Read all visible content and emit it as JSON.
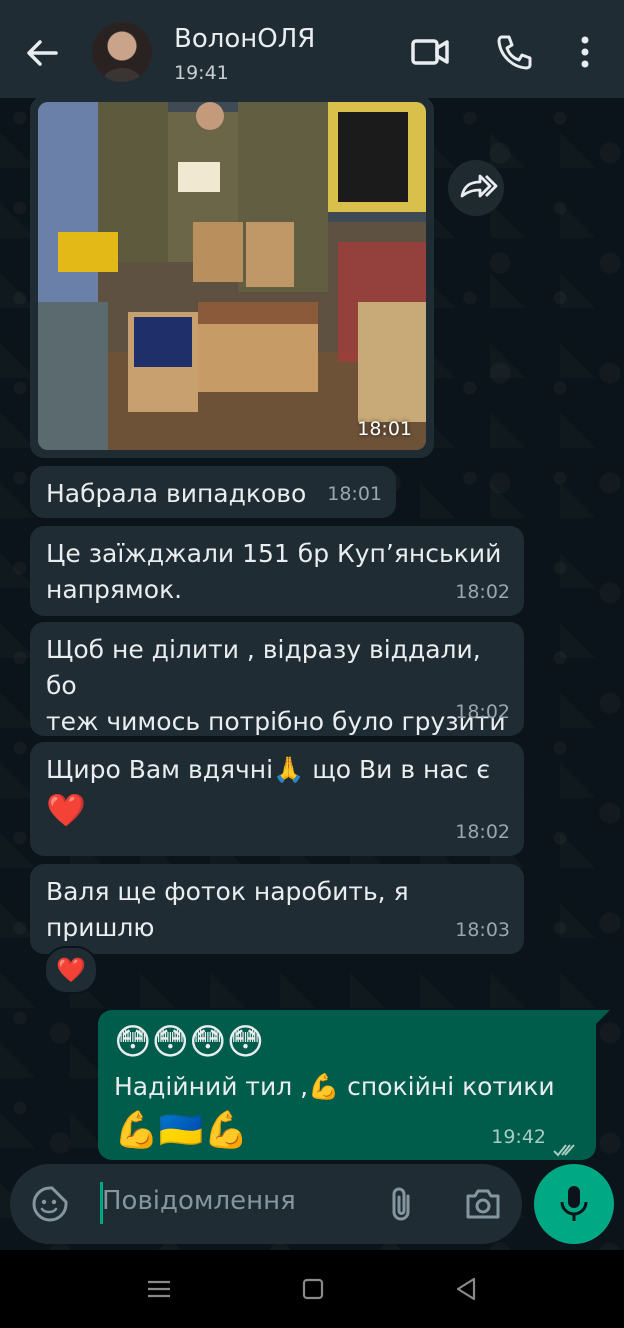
{
  "header": {
    "contact_name": "ВолонОЛЯ",
    "status": "19:41",
    "icons": [
      "back-arrow-icon",
      "video-call-icon",
      "phone-icon",
      "more-vert-icon"
    ]
  },
  "messages": {
    "photo": {
      "time": "18:01"
    },
    "m1": {
      "text": "Набрала випадково",
      "time": "18:01"
    },
    "m2": {
      "line1": "Це заїжджали 151 бр Куп’янський",
      "line2": "напрямок.",
      "time": "18:02"
    },
    "m3": {
      "line1": "Щоб не ділити , відразу віддали, бо",
      "line2": "теж чимось потрібно було грузити",
      "time": "18:02"
    },
    "m4": {
      "text_before": "Щиро Вам вдячні",
      "emoji1": "🙏",
      "text_after": " що Ви в нас є",
      "emoji2": "❤️",
      "time": "18:02"
    },
    "m5": {
      "line1": "Валя ще фоток наробить, я",
      "line2": "пришлю",
      "time": "18:03"
    },
    "reaction": "❤️"
  },
  "outgoing": {
    "emojis": "😳😳😳😳",
    "text_a": "Надійний тил ,",
    "emoji_mid": "💪",
    "text_b": " спокійні  котики",
    "emojis_end": "💪🇺🇦💪",
    "time": "19:42"
  },
  "composer": {
    "placeholder": "Повідомлення"
  },
  "colors": {
    "incoming_bubble": "#202c33",
    "outgoing_bubble": "#005c4b",
    "accent": "#00a884",
    "header_bg": "#1f2c33"
  }
}
